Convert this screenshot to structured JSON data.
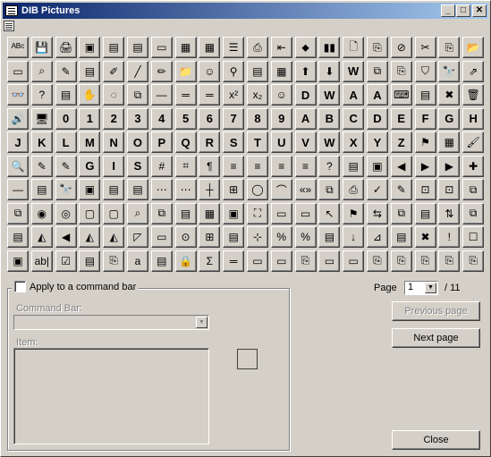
{
  "window": {
    "title": "DIB Pictures",
    "minimize_glyph": "_",
    "maximize_glyph": "□",
    "close_glyph": "✕"
  },
  "grid": {
    "cells": [
      "ᴬᴮᶜ",
      "💾",
      "🖨",
      "▣",
      "▤",
      "▤",
      "▭",
      "▦",
      "▦",
      "☰",
      "⎙",
      "⇤",
      "⬥",
      "▮▮",
      "🗋",
      "⎘",
      "⊘",
      "✂",
      "⎘",
      "📂",
      "▭",
      "⌕",
      "✎",
      "▤",
      "✐",
      "╱",
      "✏",
      "📁",
      "☺",
      "⚲",
      "▤",
      "▦",
      "⬆",
      "⬇",
      "W",
      "⧉",
      "⎘",
      "⛉",
      "🔭",
      "⇗",
      "👓",
      "?",
      "▤",
      "✋",
      "◌",
      "⧉",
      "—",
      "═",
      "═",
      "x²",
      "x₂",
      "☺",
      "D",
      "W",
      "A",
      "A",
      "⌨",
      "▤",
      "✖",
      "🗑",
      "🔊",
      "🖥",
      "0",
      "1",
      "2",
      "3",
      "4",
      "5",
      "6",
      "7",
      "8",
      "9",
      "A",
      "B",
      "C",
      "D",
      "E",
      "F",
      "G",
      "H",
      "J",
      "K",
      "L",
      "M",
      "N",
      "O",
      "P",
      "Q",
      "R",
      "S",
      "T",
      "U",
      "V",
      "W",
      "X",
      "Y",
      "Z",
      "⚑",
      "▦",
      "🖌",
      "🔍",
      "✎",
      "✎",
      "G",
      "I",
      "S",
      "#",
      "⌗",
      "¶",
      "≡",
      "≡",
      "≡",
      "≡",
      "?",
      "▤",
      "▣",
      "◀",
      "▶",
      "▶",
      "✚",
      "—",
      "▤",
      "🔭",
      "▣",
      "▤",
      "▤",
      "⋯",
      "⋯",
      "┼",
      "⊞",
      "◯",
      "⌒",
      "«»",
      "⧉",
      "⎙",
      "✓",
      "✎",
      "⊡",
      "⊡",
      "⧉",
      "⧉",
      "◉",
      "◎",
      "▢",
      "▢",
      "⌕",
      "⧉",
      "▤",
      "▦",
      "▣",
      "⛶",
      "▭",
      "▭",
      "↖",
      "⚑",
      "⇆",
      "⧉",
      "▤",
      "⇅",
      "⧉",
      "▤",
      "◭",
      "◀",
      "◭",
      "◭",
      "◸",
      "▭",
      "⊙",
      "⊞",
      "▤",
      "⊹",
      "%",
      "%",
      "▤",
      "↓",
      "⊿",
      "▤",
      "✖",
      "!",
      "☐",
      "▣",
      "ab|",
      "☑",
      "▤",
      "⎘",
      "a",
      "▤",
      "🔒",
      "Σ",
      "═",
      "▭",
      "▭",
      "⎘",
      "▭",
      "▭",
      "⎘",
      "⎘",
      "⎘",
      "⎘",
      "⎘"
    ]
  },
  "command_bar_group": {
    "apply_label": "Apply to a command bar",
    "command_bar_label": "Command Bar:",
    "command_bar_value": "",
    "item_label": "Item:"
  },
  "pager": {
    "page_label": "Page",
    "current_page": "1",
    "total": "/ 11"
  },
  "buttons": {
    "previous_page": "Previous page",
    "next_page": "Next page",
    "close": "Close"
  }
}
